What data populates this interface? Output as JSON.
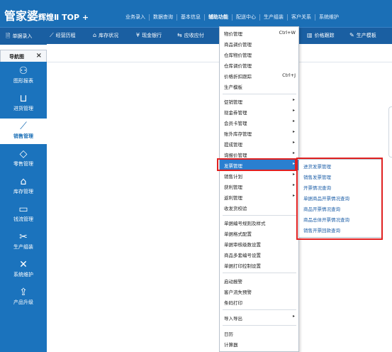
{
  "app": {
    "logo_main": "管家婆",
    "logo_sub": "辉煌Ⅱ TOP +"
  },
  "topmenu": [
    "业务录入",
    "数据查询",
    "基本信息",
    "辅助功能",
    "配送中心",
    "生产组装",
    "客户关系",
    "系统维护"
  ],
  "toolbar": {
    "items": [
      {
        "label": "单据录入",
        "icon": "document-icon"
      },
      {
        "label": "经营历程",
        "icon": "line-chart-icon"
      },
      {
        "label": "库存状况",
        "icon": "warehouse-icon"
      },
      {
        "label": "现金银行",
        "icon": "currency-icon"
      },
      {
        "label": "应收应付",
        "icon": "transfer-icon"
      },
      {
        "label": "价格跟踪",
        "icon": "chart-icon"
      },
      {
        "label": "生产模板",
        "icon": "wrench-icon"
      }
    ]
  },
  "navtab": {
    "label": "导航图",
    "close": "×"
  },
  "sidebar": {
    "items": [
      {
        "label": "图形报表",
        "icon": "grid-icon"
      },
      {
        "label": "进货管理",
        "icon": "cart-icon"
      },
      {
        "label": "销售管理",
        "icon": "trend-icon"
      },
      {
        "label": "零售管理",
        "icon": "tag-icon"
      },
      {
        "label": "库存管理",
        "icon": "house-icon"
      },
      {
        "label": "钱流管理",
        "icon": "money-icon"
      },
      {
        "label": "生产组装",
        "icon": "tools-icon"
      },
      {
        "label": "系统维护",
        "icon": "settings-icon"
      },
      {
        "label": "产品升级",
        "icon": "upload-icon"
      }
    ]
  },
  "menu": {
    "items": [
      {
        "label": "物价管理",
        "shortcut": "Ctrl+W"
      },
      {
        "label": "商品调价管理"
      },
      {
        "label": "仓库物价管理"
      },
      {
        "label": "仓库调价管理"
      },
      {
        "label": "价格折扣跟踪",
        "shortcut": "Ctrl+J"
      },
      {
        "label": "生产模板"
      },
      {
        "label": "促销管理",
        "arrow": "▸"
      },
      {
        "label": "现金券管理",
        "arrow": "▸"
      },
      {
        "label": "会员卡管理",
        "arrow": "▸"
      },
      {
        "label": "账外库存管理",
        "arrow": "▸"
      },
      {
        "label": "提成管理",
        "arrow": "▸"
      },
      {
        "label": "询报价管理",
        "arrow": "▸"
      },
      {
        "label": "发票管理",
        "arrow": "▸"
      },
      {
        "label": "销售计划",
        "arrow": "▸"
      },
      {
        "label": "获利管理",
        "arrow": "▸"
      },
      {
        "label": "返利管理",
        "arrow": "▸"
      },
      {
        "label": "收发货校验"
      },
      {
        "label": "单据编号规则及样式"
      },
      {
        "label": "单据格式配置"
      },
      {
        "label": "单据审核级数设置"
      },
      {
        "label": "商品多套编号设置"
      },
      {
        "label": "单据打印控制设置"
      },
      {
        "label": "启动报警"
      },
      {
        "label": "客户流失预警"
      },
      {
        "label": "条码打印"
      },
      {
        "label": "导入导出",
        "arrow": "▸"
      },
      {
        "label": "日历"
      },
      {
        "label": "计算器"
      }
    ]
  },
  "submenu": {
    "items": [
      "进货发票管理",
      "销售发票管理",
      "开票情况查询",
      "单据商品开票情况查询",
      "商品开票情况查询",
      "商品总体开票情况查询",
      "销售开票回款查询"
    ]
  }
}
